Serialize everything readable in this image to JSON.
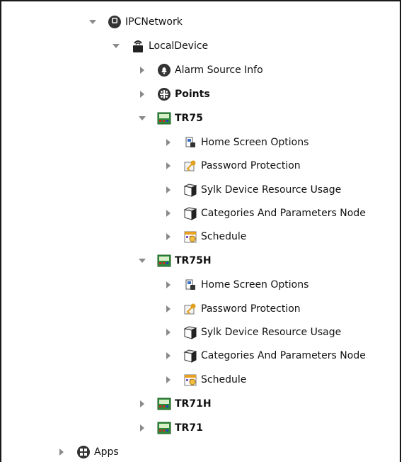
{
  "tree": {
    "ipc_network": "IPCNetwork",
    "local_device": "LocalDevice",
    "alarm_source_info": "Alarm Source Info",
    "points": "Points",
    "tr75": {
      "label": "TR75",
      "children": [
        "Home Screen Options",
        "Password Protection",
        "Sylk Device Resource Usage",
        "Categories And Parameters Node",
        "Schedule"
      ]
    },
    "tr75h": {
      "label": "TR75H",
      "children": [
        "Home Screen Options",
        "Password Protection",
        "Sylk Device Resource Usage",
        "Categories And Parameters Node",
        "Schedule"
      ]
    },
    "tr71h": "TR71H",
    "tr71": "TR71",
    "apps": "Apps"
  },
  "icons": {
    "ipc_network": "network-node-icon",
    "local_device": "local-device-icon",
    "alarm_source_info": "alarm-bell-icon",
    "points": "points-icon",
    "tr_device": "thermostat-device-icon",
    "home_screen_options": "home-screen-options-icon",
    "password_protection": "key-icon",
    "resource_usage": "cube-icon",
    "categories": "cube-icon",
    "schedule": "calendar-icon",
    "apps": "apps-icon"
  },
  "colors": {
    "toggle": "#8a8a8a",
    "icon_dark": "#333333",
    "device_green": "#2e8b3a",
    "key_gold": "#e0a020"
  }
}
